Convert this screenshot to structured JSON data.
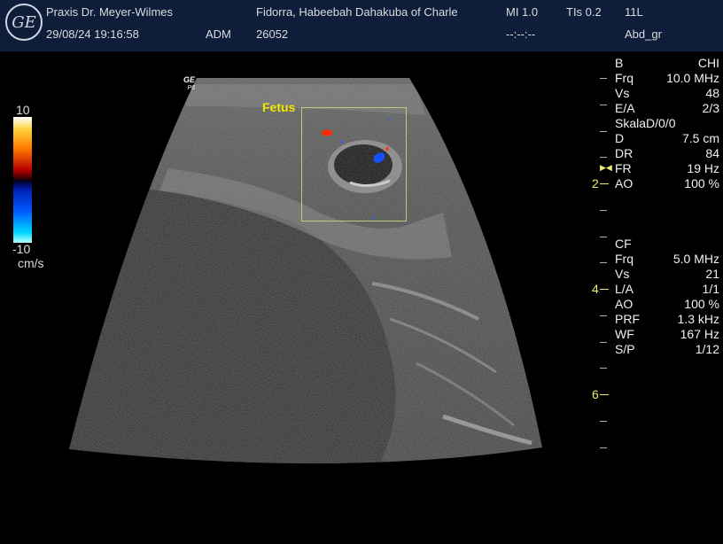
{
  "header": {
    "logo_text": "GE",
    "clinic": "Praxis Dr. Meyer-Wilmes",
    "datetime": "29/08/24 19:16:58",
    "operator": "ADM",
    "patient": "Fidorra, Habeebah Dahakuba of Charle",
    "patient_id": "26052",
    "mi": "MI 1.0",
    "tis": "TIs 0.2",
    "timer": "--:--:--",
    "probe": "11L",
    "preset": "Abd_gr"
  },
  "image": {
    "probe_mark": "GE",
    "probe_sub": "P6",
    "annotation": "Fetus"
  },
  "color_bar": {
    "max": "10",
    "min": "-10",
    "unit": "cm/s"
  },
  "b_mode": {
    "title": "B",
    "title_val": "CHI",
    "params": [
      {
        "name": "Frq",
        "value": "10.0 MHz"
      },
      {
        "name": "Vs",
        "value": "48"
      },
      {
        "name": "E/A",
        "value": "2/3"
      },
      {
        "name": "SkalaD/0/0",
        "value": ""
      },
      {
        "name": "D",
        "value": "7.5 cm"
      },
      {
        "name": "DR",
        "value": "84"
      },
      {
        "name": "FR",
        "value": "19 Hz"
      },
      {
        "name": "AO",
        "value": "100 %"
      }
    ]
  },
  "cf_mode": {
    "title": "CF",
    "params": [
      {
        "name": "Frq",
        "value": "5.0 MHz"
      },
      {
        "name": "Vs",
        "value": "21"
      },
      {
        "name": "L/A",
        "value": "1/1"
      },
      {
        "name": "AO",
        "value": "100 %"
      },
      {
        "name": "PRF",
        "value": "1.3 kHz"
      },
      {
        "name": "WF",
        "value": "167 Hz"
      },
      {
        "name": "S/P",
        "value": "1/12"
      }
    ]
  },
  "depth_labels": [
    "2",
    "4",
    "6"
  ],
  "focus_marker": "▶◀"
}
